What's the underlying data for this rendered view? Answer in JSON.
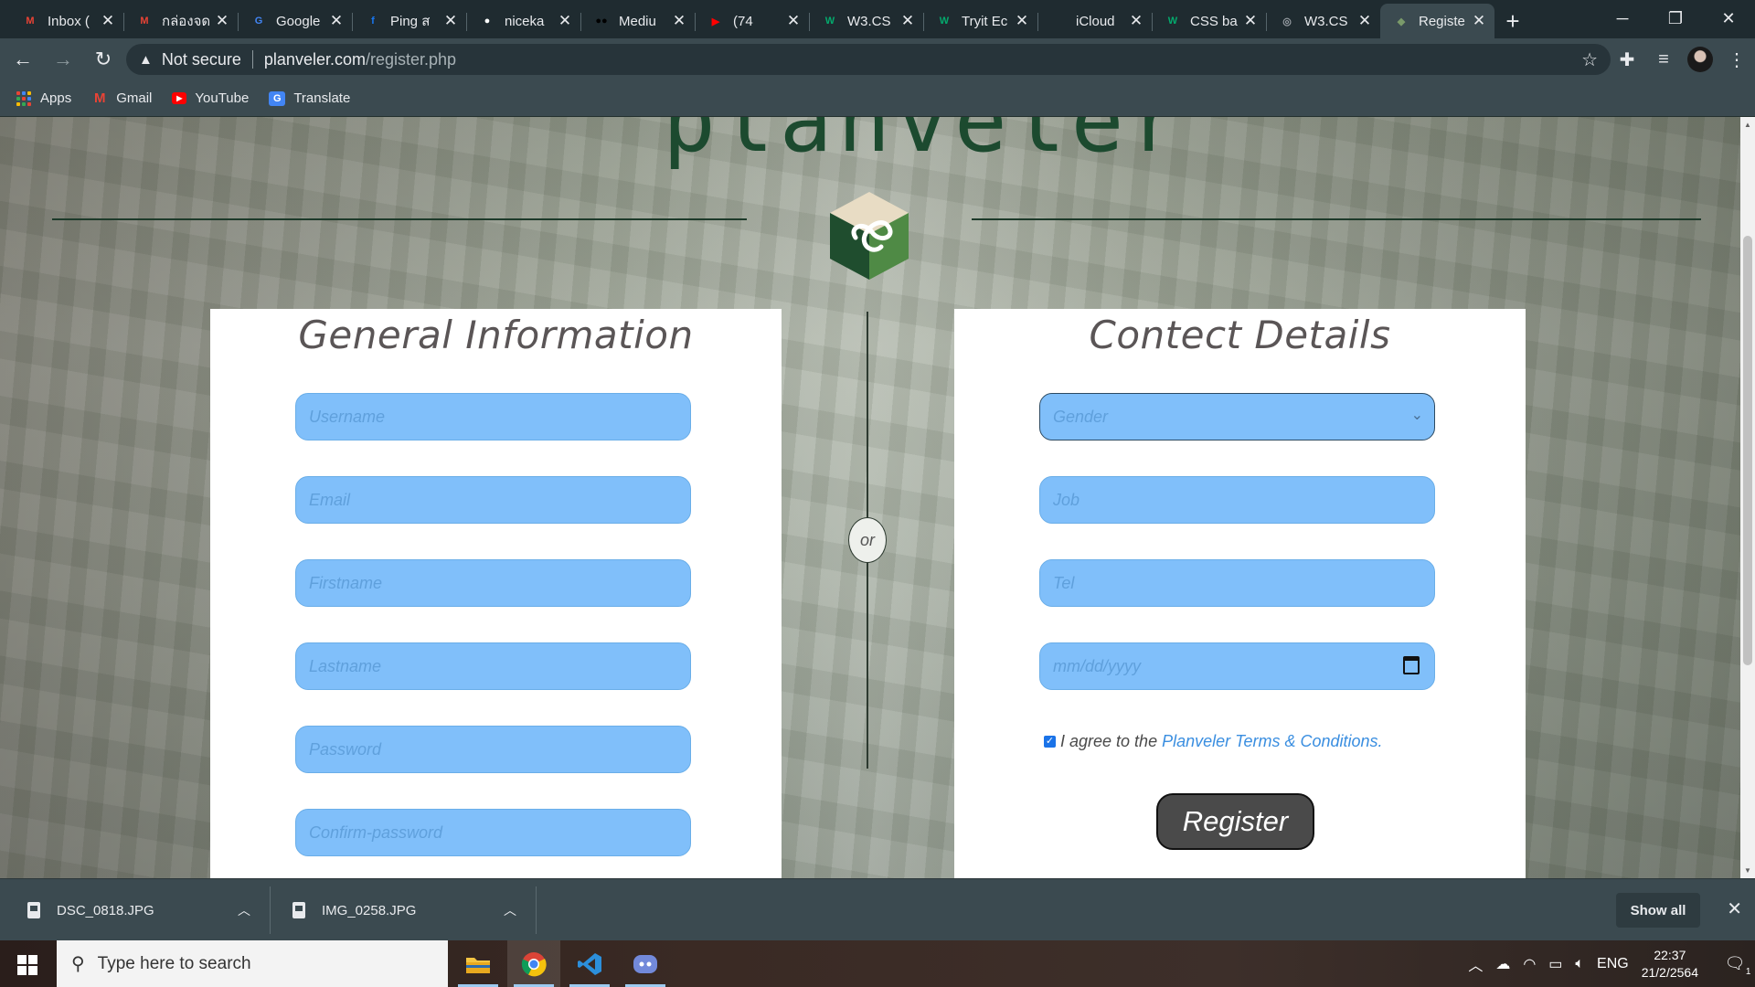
{
  "browser": {
    "tabs": [
      {
        "title": "Inbox (",
        "icon": "gmail-icon",
        "color": "#ea4335",
        "glyph": "M"
      },
      {
        "title": "กล่องจด",
        "icon": "gmail-icon",
        "color": "#ea4335",
        "glyph": "M"
      },
      {
        "title": "Google",
        "icon": "google-translate-icon",
        "color": "#4285f4",
        "glyph": "G"
      },
      {
        "title": "Ping ส",
        "icon": "facebook-icon",
        "color": "#1877f2",
        "glyph": "f"
      },
      {
        "title": "niceka",
        "icon": "github-icon",
        "color": "#ffffff",
        "glyph": "●"
      },
      {
        "title": "Mediu",
        "icon": "medium-icon",
        "color": "#000000",
        "glyph": "●●"
      },
      {
        "title": "(74",
        "icon": "youtube-icon",
        "color": "#ff0000",
        "glyph": "▶"
      },
      {
        "title": "W3.CS",
        "icon": "w3schools-icon",
        "color": "#04aa6d",
        "glyph": "W"
      },
      {
        "title": "Tryit Ec",
        "icon": "w3schools-icon",
        "color": "#04aa6d",
        "glyph": "W"
      },
      {
        "title": "iCloud",
        "icon": "apple-icon",
        "color": "#9aa0a6",
        "glyph": ""
      },
      {
        "title": "CSS ba",
        "icon": "w3schools-icon",
        "color": "#04aa6d",
        "glyph": "W"
      },
      {
        "title": "W3.CS",
        "icon": "globe-icon",
        "color": "#9aa0a6",
        "glyph": "◎"
      },
      {
        "title": "Registe",
        "icon": "planveler-cube-icon",
        "color": "#7a9a6a",
        "glyph": "◆",
        "active": true
      }
    ],
    "new_tab": "+",
    "address": {
      "security_label": "Not secure",
      "host": "planveler.com",
      "path": "/register.php"
    },
    "bookmarks": [
      "Apps",
      "Gmail",
      "YouTube",
      "Translate"
    ]
  },
  "page": {
    "brand_partial": "planveler",
    "or_label": "or",
    "general": {
      "title": "General Information",
      "fields": [
        "Username",
        "Email",
        "Firstname",
        "Lastname",
        "Password",
        "Confirm-password"
      ]
    },
    "contact": {
      "title": "Contect Details",
      "gender_placeholder": "Gender",
      "job_placeholder": "Job",
      "tel_placeholder": "Tel",
      "date_placeholder": "mm/dd/yyyy",
      "agree_text": "I agree to the",
      "agree_link": "Planveler Terms & Conditions.",
      "agree_checked": true,
      "register_label": "Register"
    }
  },
  "downloads": {
    "items": [
      "DSC_0818.JPG",
      "IMG_0258.JPG"
    ],
    "show_all": "Show all"
  },
  "taskbar": {
    "search_placeholder": "Type here to search",
    "language": "ENG",
    "time": "22:37",
    "date": "21/2/2564",
    "notification_count": "1"
  },
  "colors": {
    "field_bg": "#80bffa",
    "brand_green": "#1c4a2f",
    "link_blue": "#3a8ee0",
    "register_bg": "#4a4a4a"
  }
}
